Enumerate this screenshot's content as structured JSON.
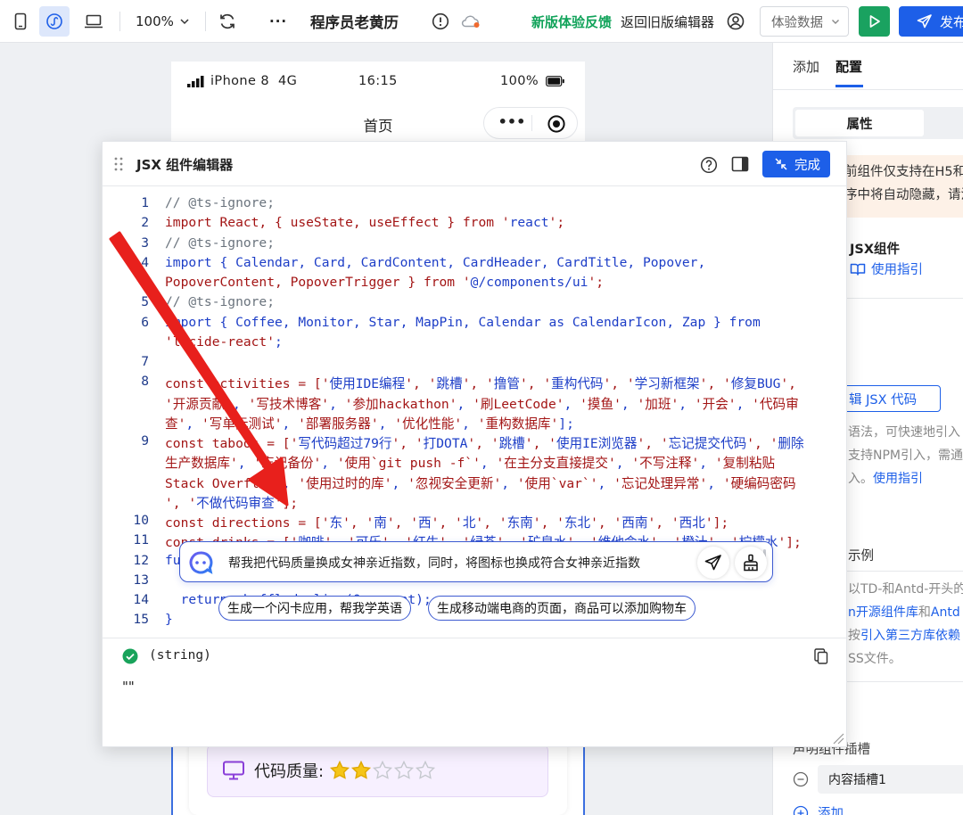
{
  "topbar": {
    "zoom": "100%",
    "more": "···",
    "app_title": "程序员老黄历",
    "feedback": "新版体验反馈",
    "return_old": "返回旧版编辑器",
    "experience_data": "体验数据",
    "publish": "发布"
  },
  "phone": {
    "signal_label": "iPhone 8  4G",
    "time": "16:15",
    "battery": "100%",
    "page_title": "首页",
    "menu_dots": "•••",
    "card_label": "代码质量:",
    "stars": 2,
    "stars_total": 5
  },
  "right_panel": {
    "tab_add": "添加",
    "tab_config": "配置",
    "seg_attributes": "属性",
    "warning_line1": "前组件仅支持在H5和",
    "warning_line2": "序中将自动隐藏，请注",
    "component_name": "JSX组件",
    "guide_link": "使用指引",
    "edit_jsx_button": "辑 JSX 代码",
    "desc_line1": "语法，可快速地引入",
    "desc_line2": "支持NPM引入，需通",
    "desc_line3": "入。",
    "desc_link": "使用指引",
    "section_example": "示例",
    "ex_line1": "以TD-和Antd-开头的",
    "ex_line2_a": "n开源组件库",
    "ex_line2_b": "和",
    "ex_line2_c": "Antd",
    "ex_line3_a": "按",
    "ex_line3_b": "引入第三方库依赖",
    "ex_line4": "SS文件。",
    "slot_title": "声明组件插槽",
    "slot_item": "内容插槽1",
    "add_label": "添加"
  },
  "modal": {
    "title": "JSX 组件编辑器",
    "done_button": "完成",
    "result_type": "(string)",
    "result_value": "\"\"",
    "ai_prompt": "帮我把代码质量换成女神亲近指数，同时，将图标也换成符合女神亲近指数",
    "suggestion_1": "生成一个闪卡应用，帮我学英语",
    "suggestion_2": "生成移动端电商的页面，商品可以添加购物车",
    "lines": [
      {
        "n": "1",
        "t": "// @ts-ignore;"
      },
      {
        "n": "2",
        "t": "import React, { useState, useEffect } from 'react';"
      },
      {
        "n": "3",
        "t": "// @ts-ignore;"
      },
      {
        "n": "4",
        "t": "import { Calendar, Card, CardContent, CardHeader, CardTitle, Popover,"
      },
      {
        "n": "",
        "t": "PopoverContent, PopoverTrigger } from '@/components/ui';"
      },
      {
        "n": "5",
        "t": "// @ts-ignore;"
      },
      {
        "n": "6",
        "t": "import { Coffee, Monitor, Star, MapPin, Calendar as CalendarIcon, Zap } from"
      },
      {
        "n": "",
        "t": "'lucide-react';"
      },
      {
        "n": "7",
        "t": ""
      },
      {
        "n": "8",
        "t": "const activities = ['使用IDE编程', '跳槽', '撸管', '重构代码', '学习新框架', '修复BUG',"
      },
      {
        "n": "",
        "t": "'开源贡献', '写技术博客', '参加hackathon', '刷LeetCode', '摸鱼', '加班', '开会', '代码审"
      },
      {
        "n": "",
        "t": "查', '写单元测试', '部署服务器', '优化性能', '重构数据库'];"
      },
      {
        "n": "9",
        "t": "const taboos = ['写代码超过79行', '打DOTA', '跳槽', '使用IE浏览器', '忘记提交代码', '删除"
      },
      {
        "n": "",
        "t": "生产数据库', '忘记备份', '使用`git push -f`', '在主分支直接提交', '不写注释', '复制粘贴"
      },
      {
        "n": "",
        "t": "Stack Overflow', '使用过时的库', '忽视安全更新', '使用`var`', '忘记处理异常', '硬编码密码"
      },
      {
        "n": "",
        "t": "', '不做代码审查'];"
      },
      {
        "n": "10",
        "t": "const directions = ['东', '南', '西', '北', '东南', '东北', '西南', '西北'];"
      },
      {
        "n": "11",
        "t": "const drinks = ['咖啡', '可乐', '红牛', '绿茶', '矿泉水', '维他命水', '橙汁', '柠檬水'];"
      },
      {
        "n": "12",
        "t": "fu"
      },
      {
        "n": "13",
        "t": ""
      },
      {
        "n": "14",
        "t": "  return shuffled.slice(0, count);"
      },
      {
        "n": "15",
        "t": "}"
      }
    ]
  },
  "colors": {
    "accent": "#1d5fe8",
    "feedback_green": "#11a35a",
    "run_green": "#1aa260",
    "arrow_red": "#e8201c"
  }
}
